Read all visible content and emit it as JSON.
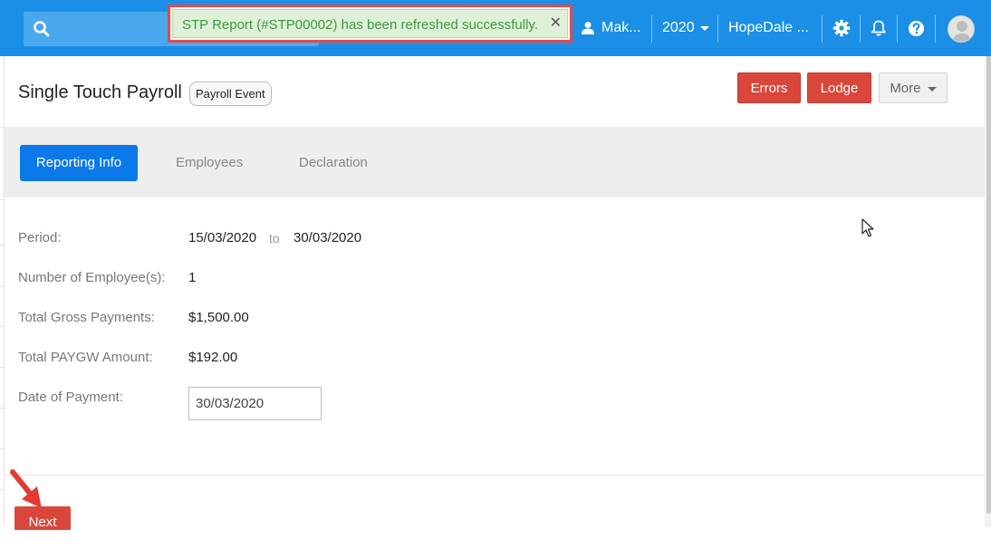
{
  "topbar": {
    "search_placeholder": "",
    "notification": {
      "message": "STP Report (#STP00002) has been refreshed successfully.",
      "close_glyph": "✕"
    },
    "user_label": "Mak...",
    "year_label": "2020",
    "company_label": "HopeDale ...",
    "icons": [
      "search-icon",
      "user-icon",
      "gear-icon",
      "bell-icon",
      "help-icon",
      "avatar"
    ]
  },
  "header": {
    "title": "Single Touch Payroll",
    "badge": "Payroll Event",
    "buttons": {
      "errors": "Errors",
      "lodge": "Lodge",
      "more": "More"
    }
  },
  "tabs": [
    {
      "label": "Reporting Info",
      "active": true
    },
    {
      "label": "Employees",
      "active": false
    },
    {
      "label": "Declaration",
      "active": false
    }
  ],
  "details": {
    "period_label": "Period:",
    "period_from": "15/03/2020",
    "period_to_word": "to",
    "period_to": "30/03/2020",
    "employees_label": "Number of Employee(s):",
    "employees_value": "1",
    "gross_label": "Total Gross Payments:",
    "gross_value": "$1,500.00",
    "paygw_label": "Total PAYGW Amount:",
    "paygw_value": "$192.00",
    "payment_date_label": "Date of Payment:",
    "payment_date_value": "30/03/2020"
  },
  "footer": {
    "next_label": "Next"
  },
  "colors": {
    "topbar": "#1b8fe6",
    "accent_red": "#d9473a",
    "tab_active": "#0b79e8",
    "success_text": "#3c9a3c"
  }
}
